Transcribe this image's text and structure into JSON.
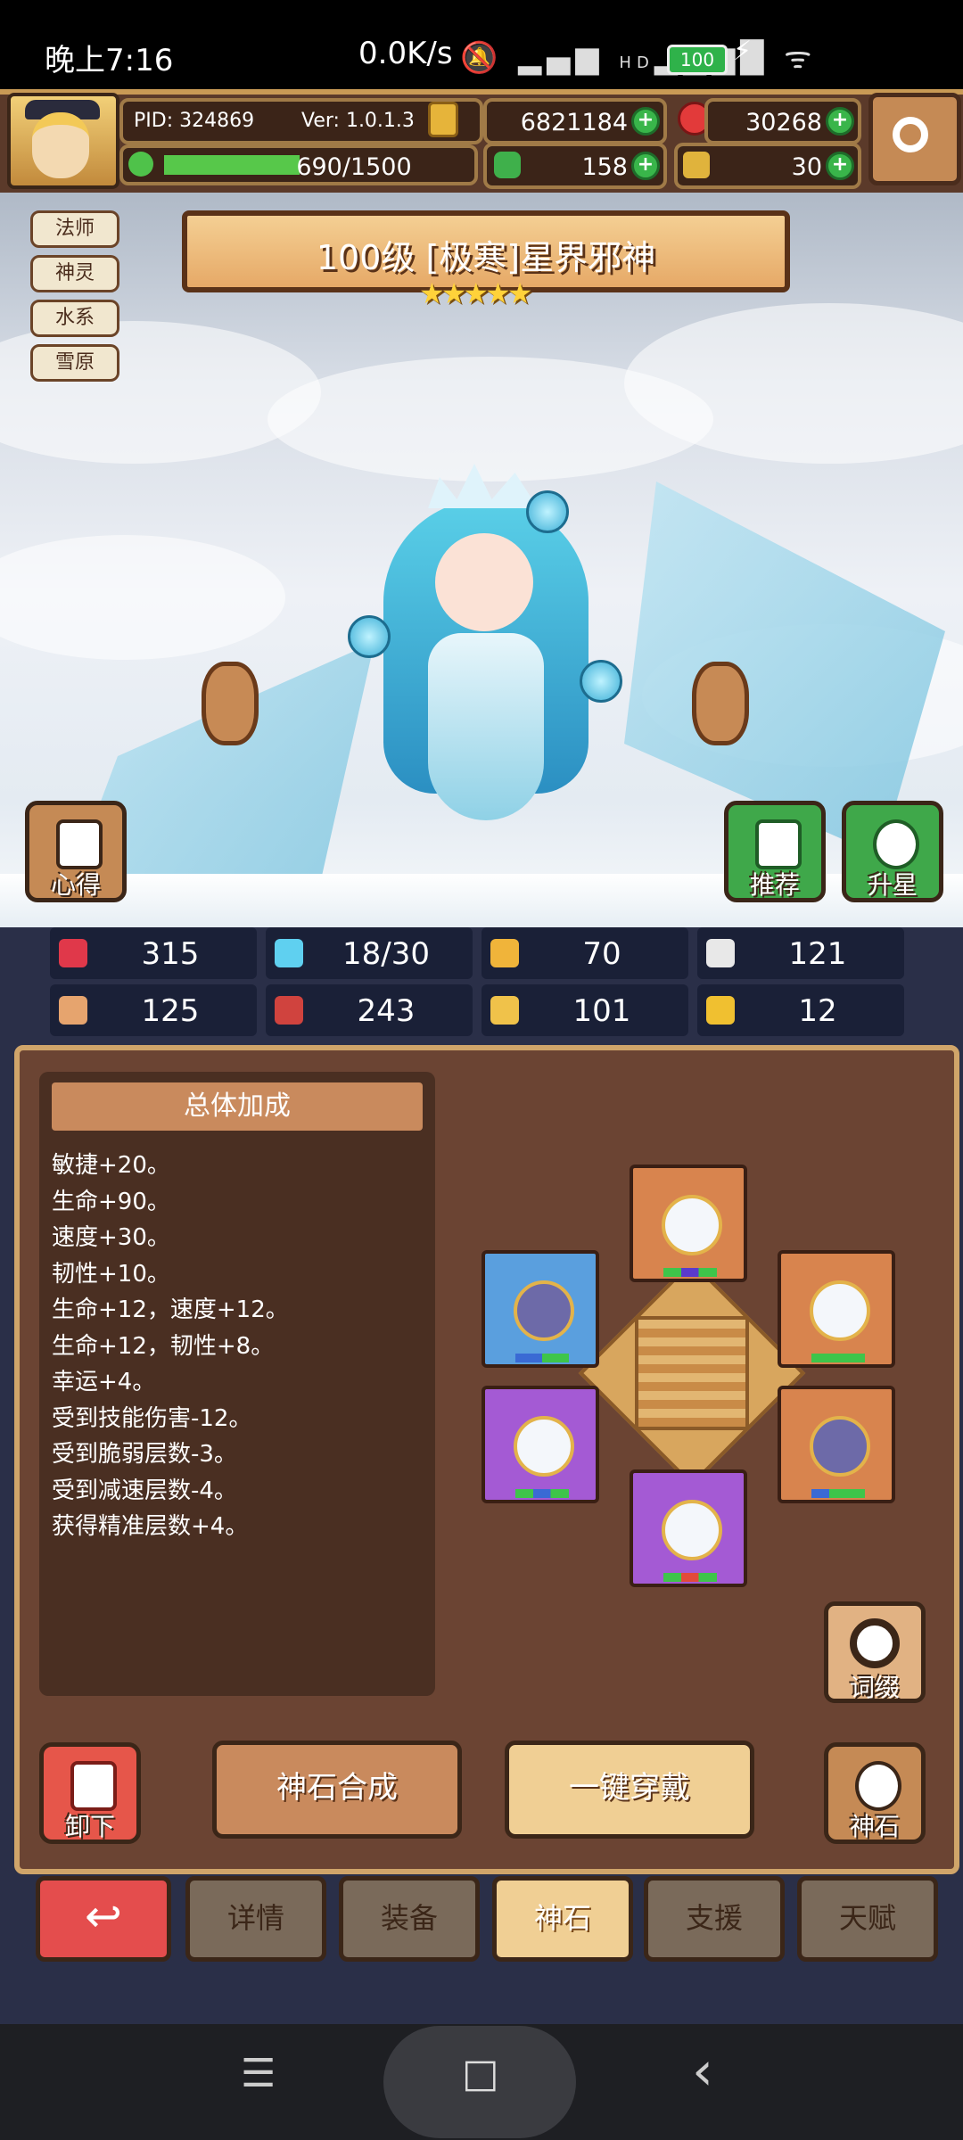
{
  "status_bar": {
    "time": "晚上7:16",
    "net_speed": "0.0K/s",
    "signal_icons": "HD",
    "battery": "100"
  },
  "header": {
    "pid": "PID: 324869",
    "version": "Ver: 1.0.1.3",
    "gold": "6821184",
    "gems": "30268",
    "exp": "690/1500",
    "exp_fraction": 0.46,
    "clover": "158",
    "keys": "30"
  },
  "tags": [
    "法师",
    "神灵",
    "水系",
    "雪原"
  ],
  "hero": {
    "title": "100级 [极寒]星界邪神",
    "stars": "★★★★★"
  },
  "side_buttons": {
    "notes": "心得",
    "recommend": "推荐",
    "star_up": "升星"
  },
  "stats": [
    {
      "icon": "heart-icon",
      "value": "315",
      "color": "#e0384a"
    },
    {
      "icon": "mana-drop-icon",
      "value": "18/30",
      "color": "#5fd0f0"
    },
    {
      "icon": "shield-icon",
      "value": "70",
      "color": "#f0b43a"
    },
    {
      "icon": "wing-icon",
      "value": "121",
      "color": "#e8e8e8"
    },
    {
      "icon": "fist-icon",
      "value": "125",
      "color": "#e6a46e"
    },
    {
      "icon": "book-icon",
      "value": "243",
      "color": "#d0433e"
    },
    {
      "icon": "stairs-icon",
      "value": "101",
      "color": "#f0c24a"
    },
    {
      "icon": "horseshoe-icon",
      "value": "12",
      "color": "#f0c030"
    }
  ],
  "bonus": {
    "header": "总体加成",
    "lines": [
      "敏捷+20。",
      "生命+90。",
      "速度+30。",
      "韧性+10。",
      "生命+12，速度+12。",
      "生命+12，韧性+8。",
      "幸运+4。",
      "受到技能伤害-12。",
      "受到脆弱层数-3。",
      "受到减速层数-4。",
      "获得精准层数+4。"
    ]
  },
  "buttons": {
    "unequip": "卸下",
    "synthesize": "神石合成",
    "equip_all": "一键穿戴",
    "affix": "词缀",
    "godstone": "神石"
  },
  "tabs": [
    "详情",
    "装备",
    "神石",
    "支援",
    "天赋"
  ],
  "nav": {
    "menu": "☰",
    "home": "□",
    "back": "‹"
  }
}
